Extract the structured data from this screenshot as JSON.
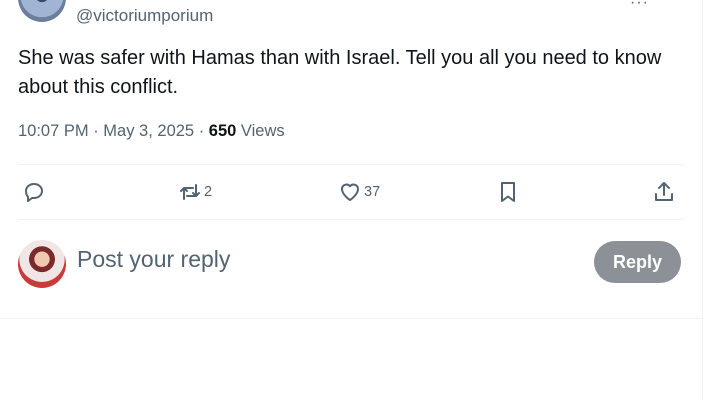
{
  "tweet": {
    "handle": "@victoriumporium",
    "more": "···",
    "text": "She was safer with Hamas than with Israel. Tell you all you need to know about this conflict.",
    "time": "10:07 PM",
    "sep1": " · ",
    "date": "May 3, 2025",
    "sep2": " · ",
    "views_count": "650",
    "views_label": " Views"
  },
  "actions": {
    "reply": {
      "icon": "reply-icon",
      "count": ""
    },
    "retweet": {
      "icon": "retweet-icon",
      "count": "2"
    },
    "like": {
      "icon": "heart-icon",
      "count": "37"
    },
    "bookmark": {
      "icon": "bookmark-icon",
      "count": ""
    },
    "share": {
      "icon": "share-icon",
      "count": ""
    }
  },
  "composer": {
    "placeholder": "Post your reply",
    "button_label": "Reply",
    "button_color": "#8b9196"
  },
  "colors": {
    "muted": "#536471",
    "text": "#0f1419",
    "divider": "#eff3f4"
  }
}
